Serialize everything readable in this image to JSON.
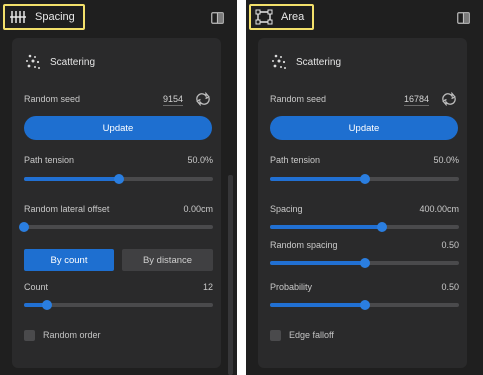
{
  "colors": {
    "panel_bg": "#1f1f1f",
    "card_bg": "#2a2a2b",
    "accent": "#1e6fd0",
    "highlight_border": "#f3e06b"
  },
  "left": {
    "header": {
      "title": "Spacing",
      "icon": "spacing-icon"
    },
    "section_title": "Scattering",
    "random_seed": {
      "label": "Random seed",
      "value": "9154"
    },
    "update_label": "Update",
    "path_tension": {
      "label": "Path tension",
      "value": "50.0%",
      "fraction": 0.5
    },
    "lateral_offset": {
      "label": "Random lateral offset",
      "value": "0.00cm",
      "fraction": 0.0
    },
    "mode": {
      "by_count": "By count",
      "by_distance": "By distance",
      "selected": "By count"
    },
    "count": {
      "label": "Count",
      "value": "12",
      "fraction": 0.12
    },
    "random_order": {
      "label": "Random order",
      "checked": false
    }
  },
  "right": {
    "header": {
      "title": "Area",
      "icon": "area-icon"
    },
    "section_title": "Scattering",
    "random_seed": {
      "label": "Random seed",
      "value": "16784"
    },
    "update_label": "Update",
    "path_tension": {
      "label": "Path tension",
      "value": "50.0%",
      "fraction": 0.5
    },
    "spacing": {
      "label": "Spacing",
      "value": "400.00cm",
      "fraction": 0.59
    },
    "random_spacing": {
      "label": "Random spacing",
      "value": "0.50",
      "fraction": 0.5
    },
    "probability": {
      "label": "Probability",
      "value": "0.50",
      "fraction": 0.5
    },
    "edge_falloff": {
      "label": "Edge falloff",
      "checked": false
    }
  }
}
